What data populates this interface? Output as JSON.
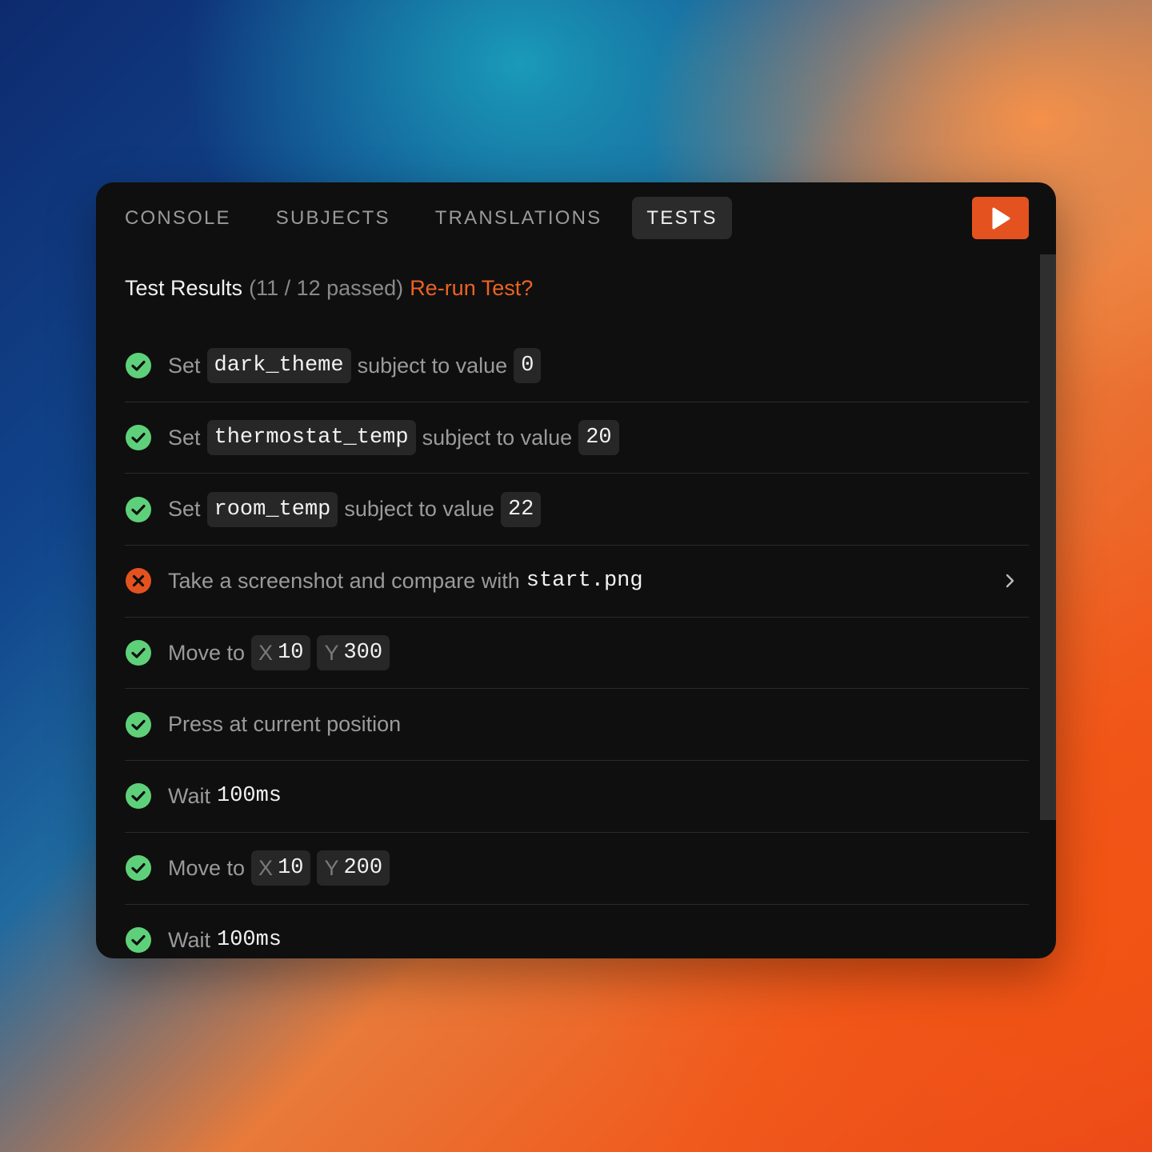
{
  "tabs": [
    {
      "label": "CONSOLE",
      "active": false
    },
    {
      "label": "SUBJECTS",
      "active": false
    },
    {
      "label": "TRANSLATIONS",
      "active": false
    },
    {
      "label": "TESTS",
      "active": true
    }
  ],
  "run_button": {
    "icon": "play-icon",
    "color": "#e3521f"
  },
  "header": {
    "title": "Test Results",
    "count": "(11 / 12 passed)",
    "rerun": "Re-run Test?"
  },
  "colors": {
    "pass": "#5fd07a",
    "fail": "#e3521f",
    "accent": "#ec6324"
  },
  "tests": [
    {
      "status": "pass",
      "prefix": "Set",
      "subject": "dark_theme",
      "middle": "subject to value",
      "value": "0"
    },
    {
      "status": "pass",
      "prefix": "Set",
      "subject": "thermostat_temp",
      "middle": "subject to value",
      "value": "20"
    },
    {
      "status": "pass",
      "prefix": "Set",
      "subject": "room_temp",
      "middle": "subject to value",
      "value": "22"
    },
    {
      "status": "fail",
      "text": "Take a screenshot and compare with",
      "file": "start.png"
    },
    {
      "status": "pass",
      "text": "Move to",
      "x_label": "X",
      "x": "10",
      "y_label": "Y",
      "y": "300"
    },
    {
      "status": "pass",
      "text": "Press at current position"
    },
    {
      "status": "pass",
      "text": "Wait",
      "duration": "100ms"
    },
    {
      "status": "pass",
      "text": "Move to",
      "x_label": "X",
      "x": "10",
      "y_label": "Y",
      "y": "200"
    },
    {
      "status": "pass",
      "text": "Wait",
      "duration": "100ms"
    }
  ]
}
